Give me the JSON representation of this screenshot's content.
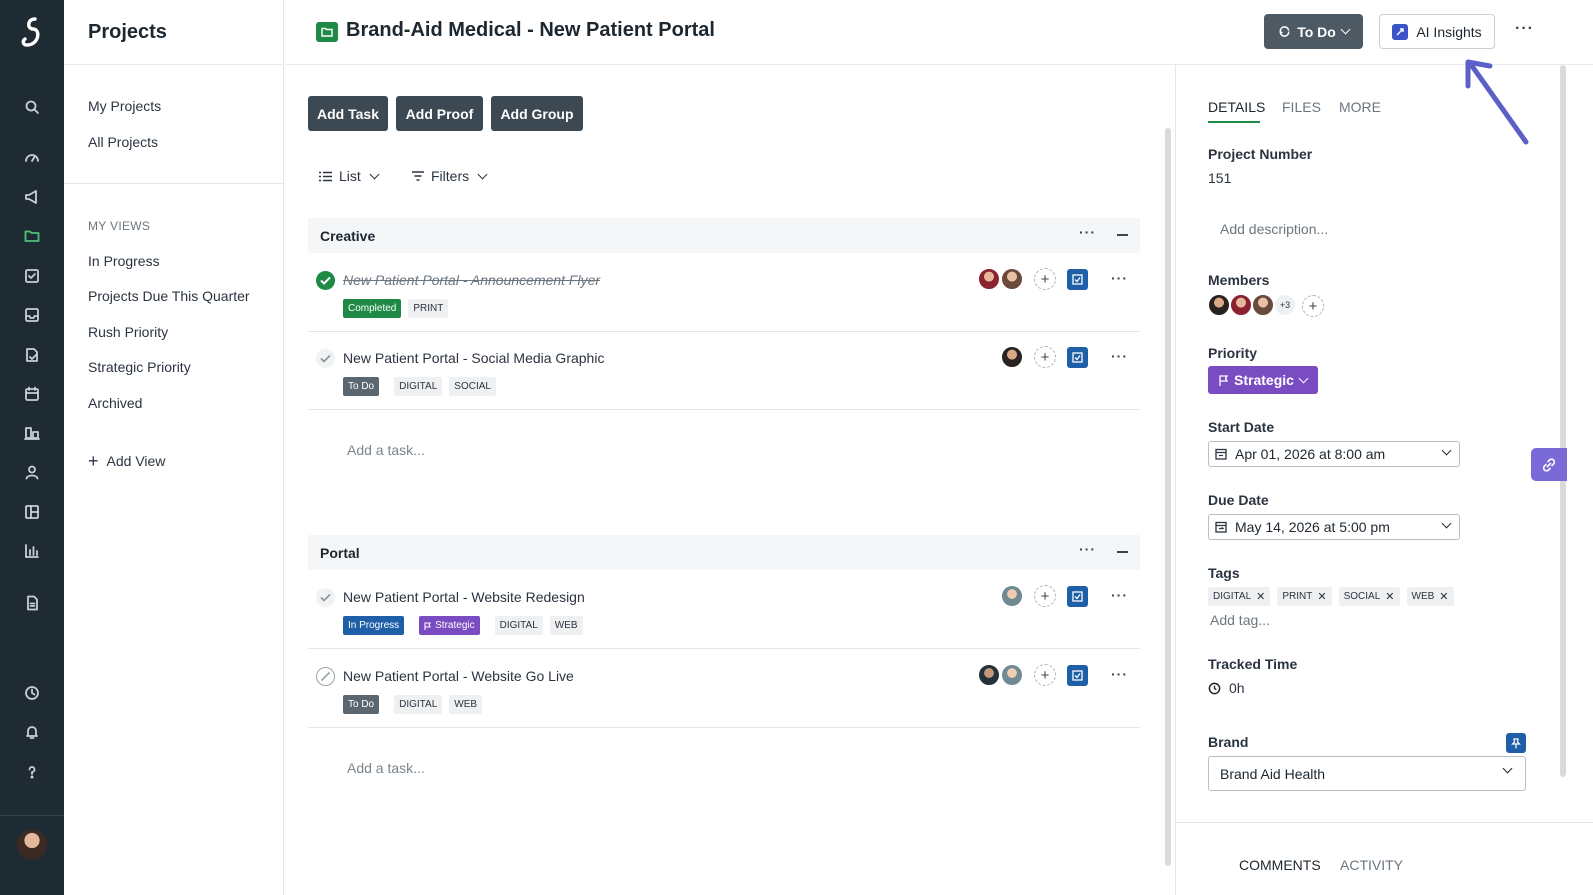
{
  "projects_panel": {
    "title": "Projects",
    "nav_top": [
      "My Projects",
      "All Projects"
    ],
    "section_label": "MY VIEWS",
    "views": [
      "In Progress",
      "Projects Due This Quarter",
      "Rush Priority",
      "Strategic Priority",
      "Archived"
    ],
    "add_view_label": "Add View"
  },
  "header": {
    "title": "Brand-Aid Medical - New Patient Portal",
    "status_label": "To Do",
    "ai_label": "AI Insights"
  },
  "toolbar": {
    "add_task": "Add Task",
    "add_proof": "Add Proof",
    "add_group": "Add Group",
    "view_label": "List",
    "filters_label": "Filters"
  },
  "groups": [
    {
      "name": "Creative",
      "tasks": [
        {
          "title": "New Patient Portal - Announcement Flyer",
          "tags": [
            "Completed",
            "PRINT"
          ]
        },
        {
          "title": "New Patient Portal - Social Media Graphic",
          "tags": [
            "To Do",
            "DIGITAL",
            "SOCIAL"
          ]
        }
      ],
      "add_task_placeholder": "Add a task..."
    },
    {
      "name": "Portal",
      "tasks": [
        {
          "title": "New Patient Portal - Website Redesign",
          "tags": [
            "In Progress",
            "Strategic",
            "DIGITAL",
            "WEB"
          ]
        },
        {
          "title": "New Patient Portal - Website Go Live",
          "tags": [
            "To Do",
            "DIGITAL",
            "WEB"
          ]
        }
      ],
      "add_task_placeholder": "Add a task..."
    }
  ],
  "details": {
    "tabs": [
      "DETAILS",
      "FILES",
      "MORE"
    ],
    "project_number_label": "Project Number",
    "project_number": "151",
    "description_placeholder": "Add description...",
    "members_label": "Members",
    "members_extra": "+3",
    "priority_label": "Priority",
    "priority_value": "Strategic",
    "start_date_label": "Start Date",
    "start_date": "Apr 01, 2026 at 8:00 am",
    "due_date_label": "Due Date",
    "due_date": "May 14, 2026 at 5:00 pm",
    "tags_label": "Tags",
    "tags": [
      "DIGITAL",
      "PRINT",
      "SOCIAL",
      "WEB"
    ],
    "add_tag_placeholder": "Add tag...",
    "tracked_time_label": "Tracked Time",
    "tracked_time": "0h",
    "brand_label": "Brand",
    "brand_value": "Brand Aid Health",
    "bottom_tabs": [
      "COMMENTS",
      "ACTIVITY"
    ]
  },
  "colors": {
    "rail_bg": "#1f2b33",
    "brand_green": "#1e8a45",
    "status_gray": "#4d5963",
    "priority_purple": "#7a4cc2",
    "accent_blue": "#1f5fa8",
    "arrow_annotation": "#5b5fc7"
  },
  "icons": {
    "rail": [
      "logo-icon",
      "search-icon",
      "dashboard-icon",
      "megaphone-icon",
      "folder-icon",
      "tasks-icon",
      "inbox-icon",
      "proof-icon",
      "calendar-icon",
      "reports-icon",
      "people-icon",
      "board-icon",
      "chart-icon",
      "document-icon",
      "clock-icon",
      "bell-icon",
      "help-icon"
    ]
  }
}
